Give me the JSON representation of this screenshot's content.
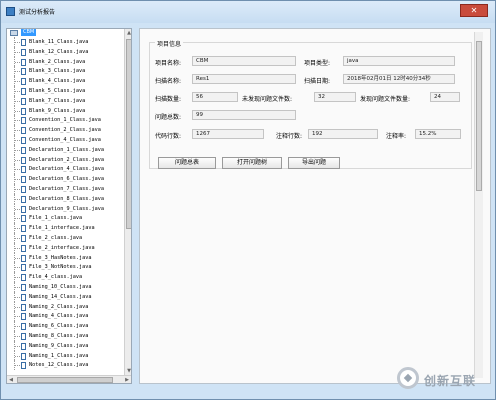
{
  "window": {
    "title": "测试分析报告",
    "close_symbol": "✕"
  },
  "tree": {
    "root_label": "CBM",
    "items": [
      "Blank_11_Class.java",
      "Blank_12_Class.java",
      "Blank_2_Class.java",
      "Blank_3_Class.java",
      "Blank_4_Class.java",
      "Blank_5_Class.java",
      "Blank_7_Class.java",
      "Blank_9_Class.java",
      "Convention_1_Class.java",
      "Convention_2_Class.java",
      "Convention_4_Class.java",
      "Declaration_1_Class.java",
      "Declaration_2_Class.java",
      "Declaration_4_Class.java",
      "Declaration_6_Class.java",
      "Declaration_7_Class.java",
      "Declaration_8_Class.java",
      "Declaration_9_Class.java",
      "File_1_class.java",
      "File_1_interface.java",
      "File_2_class.java",
      "File_2_interface.java",
      "File_3_HasNotes.java",
      "File_3_NotNotes.java",
      "File_4_class.java",
      "Naming_10_Class.java",
      "Naming_14_Class.java",
      "Naming_2_Class.java",
      "Naming_4_Class.java",
      "Naming_6_Class.java",
      "Naming_8_Class.java",
      "Naming_9_Class.java",
      "Naming_1_Class.java",
      "Notes_12_Class.java"
    ]
  },
  "project_info": {
    "group_title": "项目信息",
    "project_name_label": "项目名称:",
    "project_name_value": "CBM",
    "project_type_label": "项目类型:",
    "project_type_value": "java",
    "scan_name_label": "扫描名称:",
    "scan_name_value": "Res1",
    "scan_date_label": "扫描日期:",
    "scan_date_value": "2018年02月01日 12时40分34秒",
    "scan_count_label": "扫描数量:",
    "scan_count_value": "56",
    "no_issue_label": "未发现问题文件数:",
    "no_issue_value": "32",
    "issue_files_label": "发现问题文件数量:",
    "issue_files_value": "24",
    "issue_total_label": "问题总数:",
    "issue_total_value": "99",
    "code_lines_label": "代码行数:",
    "code_lines_value": "1267",
    "comment_lines_label": "注释行数:",
    "comment_lines_value": "192",
    "comment_rate_label": "注释率:",
    "comment_rate_value": "15.2%"
  },
  "actions": {
    "summary_label": "问题总表",
    "open_issue_label": "打开问题树",
    "export_label": "导出问题"
  },
  "watermark": {
    "text": "创新互联"
  }
}
